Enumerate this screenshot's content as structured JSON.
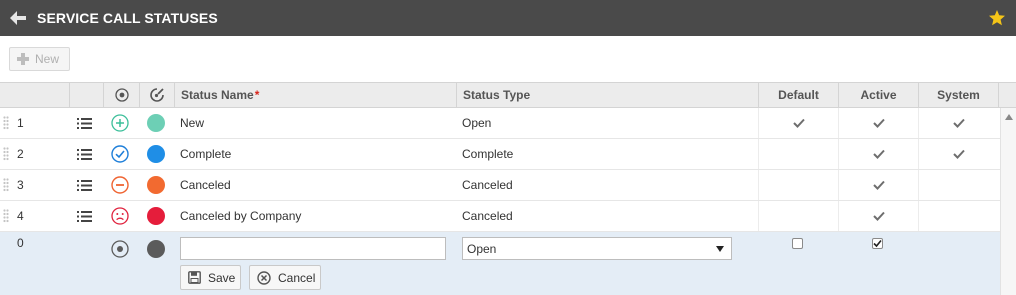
{
  "titlebar": {
    "title": "SERVICE CALL STATUSES",
    "back_icon": "arrow-left-icon",
    "favorite_icon": "star-icon",
    "star_color": "#f5c518"
  },
  "toolbar": {
    "new_label": "New"
  },
  "columns": {
    "status_name": "Status Name",
    "required_marker": "*",
    "status_type": "Status Type",
    "default": "Default",
    "active": "Active",
    "system": "System"
  },
  "rows": [
    {
      "num": "1",
      "status_icon": "plus-circle-icon",
      "icon_color": "#3cbf9a",
      "color": "#6dcfb5",
      "name": "New",
      "type": "Open",
      "default": true,
      "active": true,
      "system": true
    },
    {
      "num": "2",
      "status_icon": "check-circle-icon",
      "icon_color": "#1f7fd9",
      "color": "#1f8ee6",
      "name": "Complete",
      "type": "Complete",
      "default": false,
      "active": true,
      "system": true
    },
    {
      "num": "3",
      "status_icon": "minus-circle-icon",
      "icon_color": "#ef6432",
      "color": "#f26a30",
      "name": "Canceled",
      "type": "Canceled",
      "default": false,
      "active": true,
      "system": false
    },
    {
      "num": "4",
      "status_icon": "sad-face-icon",
      "icon_color": "#e0223e",
      "color": "#e51d3b",
      "name": "Canceled by Company",
      "type": "Canceled",
      "default": false,
      "active": true,
      "system": false
    }
  ],
  "edit_row": {
    "num": "0",
    "status_icon": "radio-circle-icon",
    "color": "#5b5b5b",
    "name_value": "",
    "type_value": "Open",
    "default_checked": false,
    "active_checked": true,
    "save_label": "Save",
    "cancel_label": "Cancel"
  }
}
